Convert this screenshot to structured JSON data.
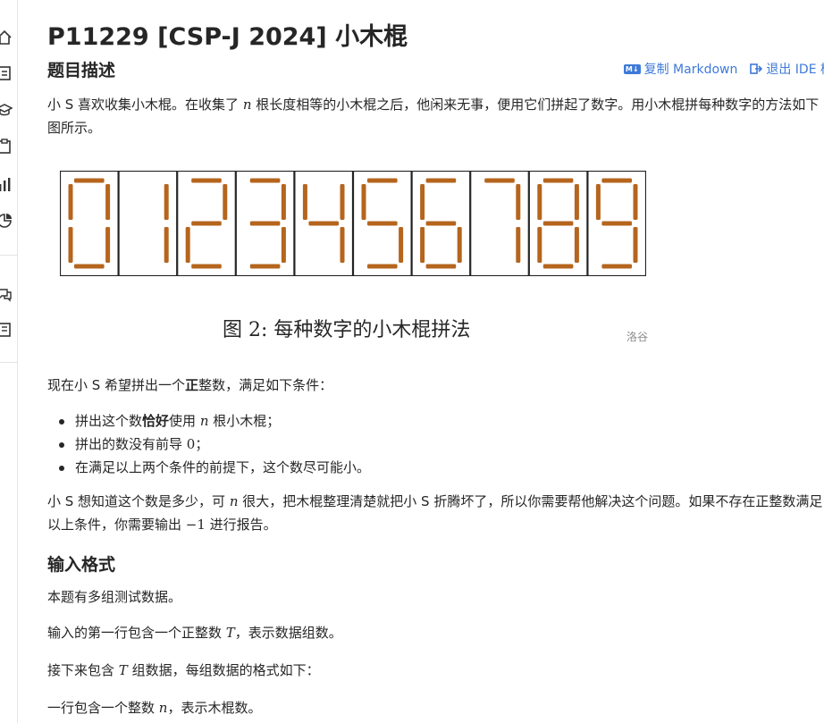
{
  "problem": {
    "title": "P11229 [CSP-J 2024] 小木棍"
  },
  "actions": {
    "copy_markdown": "复制 Markdown",
    "exit_ide": "退出 IDE 模式",
    "m4_badge": "M↓"
  },
  "sections": {
    "description": "题目描述",
    "input_format": "输入格式"
  },
  "description": {
    "p1_a": "小 S 喜欢收集小木棍。在收集了 ",
    "p1_var": "n",
    "p1_b": " 根长度相等的小木棍之后，他闲来无事，便用它们拼起了数字。用小木棍拼每种数字的方法如下图所示。",
    "figure_caption": "图 2: 每种数字的小木棍拼法",
    "figure_credit": "洛谷",
    "digits": [
      0,
      1,
      2,
      3,
      4,
      5,
      6,
      7,
      8,
      9
    ],
    "p2_a": "现在小 S 希望拼出一个",
    "p2_bold": "正",
    "p2_b": "整数，满足如下条件：",
    "cond1_a": "拼出这个数",
    "cond1_bold": "恰好",
    "cond1_b": "使用 ",
    "cond1_var": "n",
    "cond1_c": " 根小木棍；",
    "cond2_a": "拼出的数没有前导 ",
    "cond2_num": "0",
    "cond2_b": "；",
    "cond3": "在满足以上两个条件的前提下，这个数尽可能小。",
    "p3_a": "小 S 想知道这个数是多少，可 ",
    "p3_var": "n",
    "p3_b": " 很大，把木棍整理清楚就把小 S 折腾坏了，所以你需要帮他解决这个问题。如果不存在正整数满足以上条件，你需要输出 ",
    "p3_num": "−1",
    "p3_c": " 进行报告。"
  },
  "input_format": {
    "line1": "本题有多组测试数据。",
    "line2_a": "输入的第一行包含一个正整数 ",
    "line2_var": "T",
    "line2_b": "，表示数据组数。",
    "line3_a": "接下来包含 ",
    "line3_var": "T",
    "line3_b": " 组数据，每组数据的格式如下：",
    "line4_a": "一行包含一个整数 ",
    "line4_var": "n",
    "line4_b": "，表示木棍数。"
  },
  "colors": {
    "stick": "#b5651d",
    "link": "#3e7ad9",
    "text": "#262626"
  },
  "sidebar_icons": [
    "home-icon",
    "list-icon",
    "graduation-cap-icon",
    "clipboard-icon",
    "bar-chart-icon",
    "pie-chart-icon",
    "chat-icon",
    "book-icon"
  ]
}
